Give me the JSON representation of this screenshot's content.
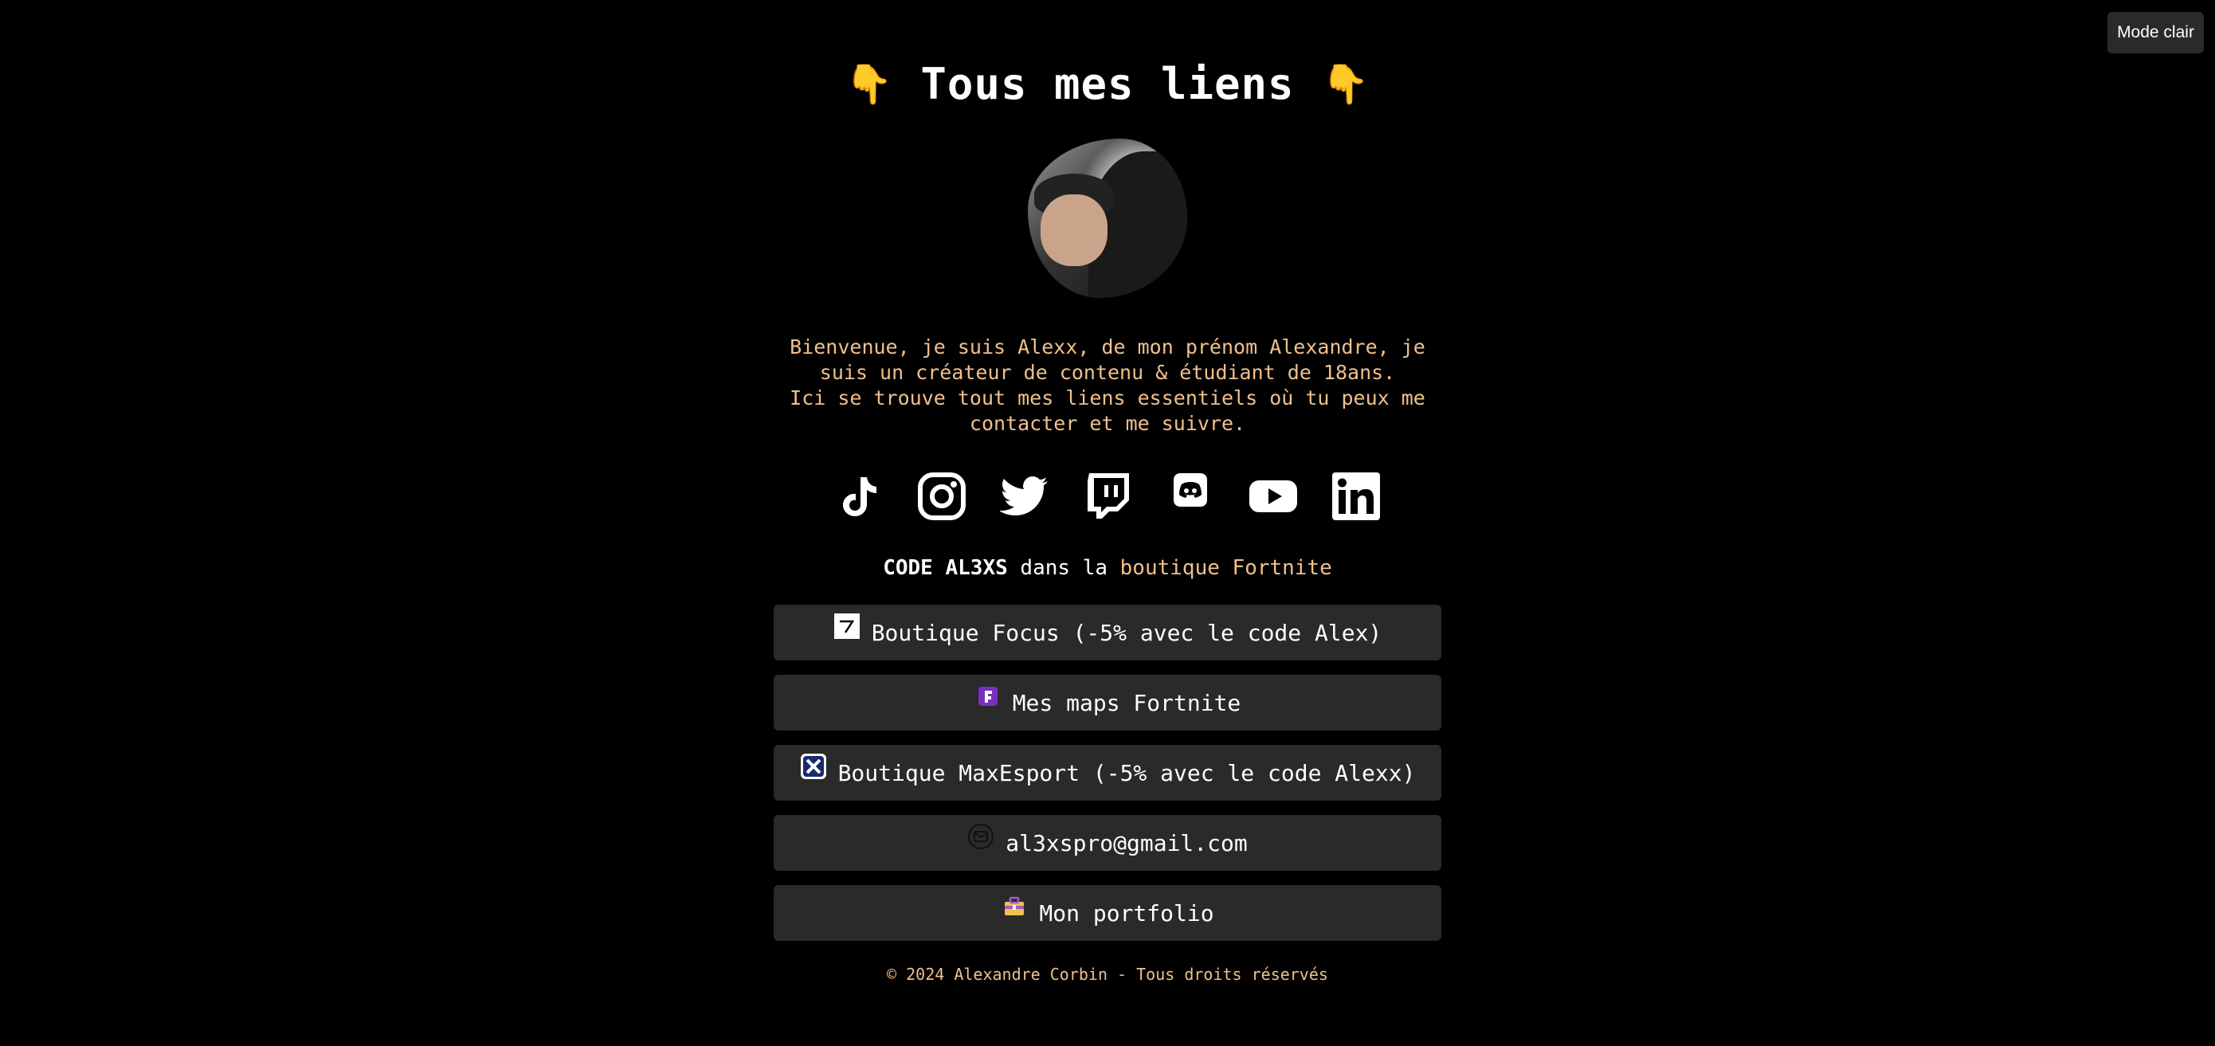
{
  "theme_toggle": {
    "label": "Mode clair"
  },
  "header": {
    "title": "Tous mes liens",
    "emoji_left": "👇",
    "emoji_right": "👇"
  },
  "bio": {
    "line1": "Bienvenue, je suis Alexx, de mon prénom Alexandre, je suis un créateur de contenu & étudiant de 18ans.",
    "line2": "Ici se trouve tout mes liens essentiels où tu peux me contacter et me suivre."
  },
  "socials": [
    {
      "icon": "tiktok-icon"
    },
    {
      "icon": "instagram-icon"
    },
    {
      "icon": "twitter-icon"
    },
    {
      "icon": "twitch-icon"
    },
    {
      "icon": "discord-icon"
    },
    {
      "icon": "youtube-icon"
    },
    {
      "icon": "linkedin-icon"
    }
  ],
  "creator_code": {
    "code": "CODE AL3XS",
    "middle": "dans la",
    "link": "boutique Fortnite"
  },
  "links": [
    {
      "label": "Boutique Focus (-5% avec le code Alex)",
      "icon": "focus-logo-icon"
    },
    {
      "label": "Mes maps Fortnite",
      "icon": "fortnite-icon"
    },
    {
      "label": "Boutique MaxEsport (-5% avec le code Alexx)",
      "icon": "maxesport-icon"
    },
    {
      "label": "al3xspro@gmail.com",
      "icon": "email-icon"
    },
    {
      "label": "Mon portfolio",
      "icon": "briefcase-icon"
    }
  ],
  "footer": {
    "text": "© 2024 Alexandre Corbin - Tous droits réservés"
  },
  "colors": {
    "background": "#000000",
    "accent": "#f0c08c",
    "button": "#2a2a2a"
  }
}
